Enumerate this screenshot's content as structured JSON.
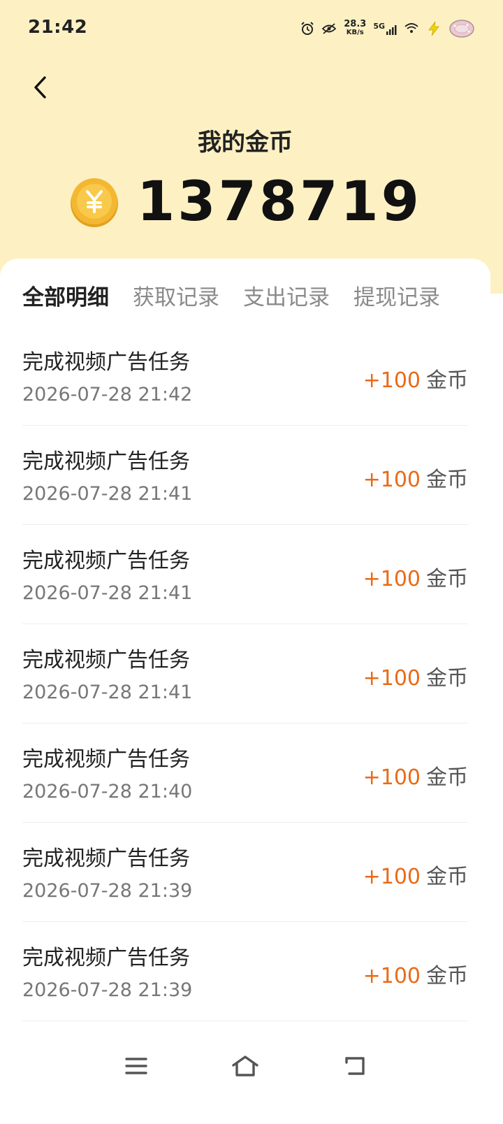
{
  "status_bar": {
    "time": "21:42",
    "net_speed_value": "28.3",
    "net_speed_unit": "KB/s",
    "network_type": "5G",
    "icons": [
      "alarm-icon",
      "eye-off-icon",
      "signal-icon",
      "wifi-icon",
      "charging-icon",
      "battery-icon"
    ]
  },
  "header": {
    "title": "我的金币",
    "balance": "1378719",
    "coin_symbol": "¥"
  },
  "tabs": [
    {
      "label": "全部明细",
      "active": true
    },
    {
      "label": "获取记录",
      "active": false
    },
    {
      "label": "支出记录",
      "active": false
    },
    {
      "label": "提现记录",
      "active": false
    }
  ],
  "records": [
    {
      "title": "完成视频广告任务",
      "time": "2026-07-28 21:42",
      "amount": "+100",
      "unit": "金币"
    },
    {
      "title": "完成视频广告任务",
      "time": "2026-07-28 21:41",
      "amount": "+100",
      "unit": "金币"
    },
    {
      "title": "完成视频广告任务",
      "time": "2026-07-28 21:41",
      "amount": "+100",
      "unit": "金币"
    },
    {
      "title": "完成视频广告任务",
      "time": "2026-07-28 21:41",
      "amount": "+100",
      "unit": "金币"
    },
    {
      "title": "完成视频广告任务",
      "time": "2026-07-28 21:40",
      "amount": "+100",
      "unit": "金币"
    },
    {
      "title": "完成视频广告任务",
      "time": "2026-07-28 21:39",
      "amount": "+100",
      "unit": "金币"
    },
    {
      "title": "完成视频广告任务",
      "time": "2026-07-28 21:39",
      "amount": "+100",
      "unit": "金币"
    }
  ],
  "colors": {
    "header_bg": "#fdf1c4",
    "amount": "#ea6a16",
    "coin": "#f4b731"
  },
  "navbar": {
    "icons": [
      "menu-icon",
      "home-icon",
      "back-nav-icon"
    ]
  }
}
